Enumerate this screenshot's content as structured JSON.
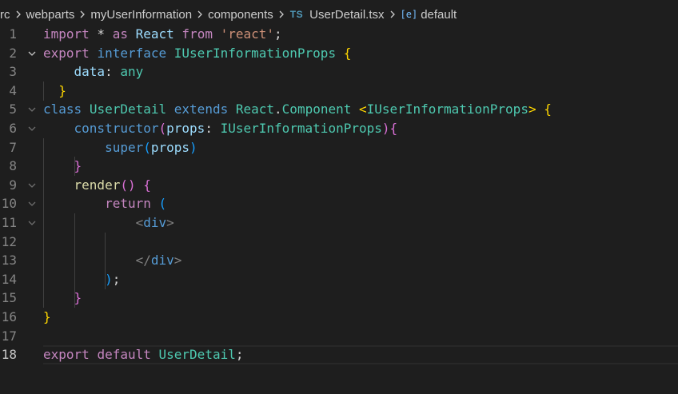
{
  "breadcrumb": {
    "items": [
      "rc",
      "webparts",
      "myUserInformation",
      "components"
    ],
    "file_icon": "TS",
    "file_name": "UserDetail.tsx",
    "symbol_icon": "[e]",
    "symbol_name": "default"
  },
  "line_numbers": [
    "1",
    "2",
    "3",
    "4",
    "5",
    "6",
    "7",
    "8",
    "9",
    "10",
    "11",
    "12",
    "13",
    "14",
    "15",
    "16",
    "17",
    "18"
  ],
  "code": {
    "l1": {
      "t1": "import",
      "t2": " * ",
      "t3": "as",
      "t4": " ",
      "t5": "React",
      "t6": " ",
      "t7": "from",
      "t8": " ",
      "t9": "'react'",
      "t10": ";"
    },
    "l2": {
      "t1": "export",
      "t2": " ",
      "t3": "interface",
      "t4": " ",
      "t5": "IUserInformationProps",
      "t6": " ",
      "t7": "{"
    },
    "l3": {
      "t1": "    ",
      "t2": "data",
      "t3": ": ",
      "t4": "any"
    },
    "l4": {
      "t1": "  ",
      "t2": "}"
    },
    "l5": {
      "t1": "class",
      "t2": " ",
      "t3": "UserDetail",
      "t4": " ",
      "t5": "extends",
      "t6": " ",
      "t7": "React",
      "t8": ".",
      "t9": "Component",
      "t10": " ",
      "t11": "<",
      "t12": "IUserInformationProps",
      "t13": ">",
      "t14": " ",
      "t15": "{"
    },
    "l6": {
      "t1": "    ",
      "t2": "constructor",
      "t3": "(",
      "t4": "props",
      "t5": ": ",
      "t6": "IUserInformationProps",
      "t7": ")",
      "t8": "{"
    },
    "l7": {
      "t1": "        ",
      "t2": "super",
      "t3": "(",
      "t4": "props",
      "t5": ")"
    },
    "l8": {
      "t1": "    ",
      "t2": "}"
    },
    "l9": {
      "t1": "    ",
      "t2": "render",
      "t3": "()",
      "t4": " ",
      "t5": "{"
    },
    "l10": {
      "t1": "        ",
      "t2": "return",
      "t3": " ",
      "t4": "("
    },
    "l11": {
      "t1": "            ",
      "t2": "<",
      "t3": "div",
      "t4": ">"
    },
    "l12": {
      "t1": ""
    },
    "l13": {
      "t1": "            ",
      "t2": "</",
      "t3": "div",
      "t4": ">"
    },
    "l14": {
      "t1": "        ",
      "t2": ")",
      "t3": ";"
    },
    "l15": {
      "t1": "    ",
      "t2": "}"
    },
    "l16": {
      "t1": "}"
    },
    "l17": {
      "t1": ""
    },
    "l18": {
      "t1": "export",
      "t2": " ",
      "t3": "default",
      "t4": " ",
      "t5": "UserDetail",
      "t6": ";"
    }
  },
  "colors": {
    "background": "#1e1e1e",
    "keyword": "#569cd6",
    "control": "#c586c0",
    "type": "#4ec9b0",
    "string": "#ce9178",
    "variable": "#9cdcfe",
    "function": "#dcdcaa",
    "bracket_1": "#ffd700",
    "bracket_2": "#da70d6",
    "bracket_3": "#179fff"
  },
  "icons": {
    "breadcrumb_separator": "chevron-right-icon",
    "fold": "chevron-down-icon",
    "file": "typescript-file-icon",
    "symbol": "variable-symbol-icon"
  }
}
